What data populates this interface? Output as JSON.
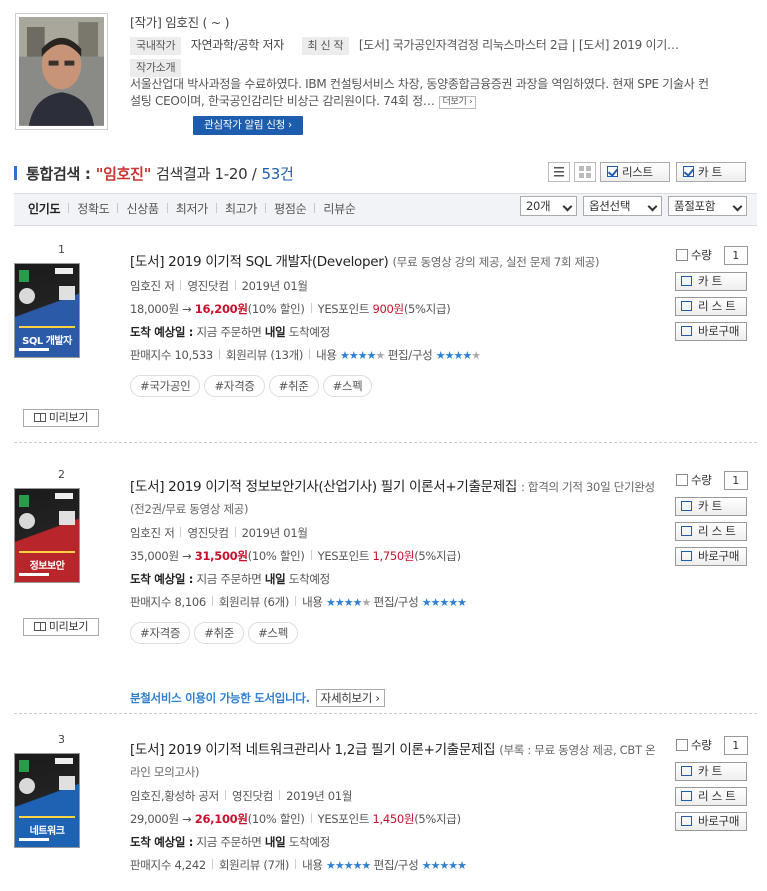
{
  "author": {
    "name_line": "[작가] 임호진 ( ~ )",
    "domestic_tag": "국내작가",
    "field": "자연과학/공학 저자",
    "latest_tag": "최 신 작",
    "latest_works": "[도서] 국가공인자격검정 리눅스마스터 2급  |  [도서] 2019 이기…",
    "intro_tag": "작가소개",
    "intro_text": "서울산업대 박사과정을 수료하였다. IBM 컨설팅서비스 차장, 동양종합금융증권 과장을 역임하였다. 현재 SPE 기술사 컨설팅 CEO이며, 한국공인감리단 비상근 감리원이다. 74회 정…",
    "more_label": "더보기",
    "alert_button": "관심작가 알림 신청"
  },
  "search": {
    "label": "통합검색 :",
    "query": "\"임호진\"",
    "result_text": "검색결과 1-20 /",
    "total": "53건",
    "list_button": "리스트",
    "cart_button": "카 트"
  },
  "sort": {
    "items": [
      "인기도",
      "정확도",
      "신상품",
      "최저가",
      "최고가",
      "평점순",
      "리뷰순"
    ],
    "per_page": "20개",
    "option_select": "옵션선택",
    "stock_select": "품절포함"
  },
  "common": {
    "preview_label": "미리보기",
    "qty_label": "수량",
    "qty_value": "1",
    "cart_btn": "카 트",
    "list_btn": "리 스 트",
    "buy_btn": "바로구매",
    "arrive_label": "도착 예상일 :",
    "arrive_text": "지금 주문하면",
    "arrive_day": "내일",
    "arrive_suffix": "도착예정",
    "content_label": "내용",
    "edit_label": "편집/구성"
  },
  "books": [
    {
      "rank": "1",
      "title": "[도서] 2019 이기적 SQL 개발자(Developer)",
      "subtitle": "(무료 동영상 강의 제공, 실전 문제 7회 제공)",
      "author": "임호진 저",
      "publisher": "영진닷컴",
      "date": "2019년 01월",
      "list_price": "18,000원 →",
      "sale_price": "16,200원",
      "discount": "(10% 할인)",
      "points_label": "YES포인트",
      "points": "900원",
      "points_rate": "(5%지급)",
      "sales_index": "판매지수 10,533",
      "reviews": "회원리뷰 (13개)",
      "content_rating": 4,
      "edit_rating": 4,
      "tags": [
        "#국가공인",
        "#자격증",
        "#취준",
        "#스펙"
      ],
      "cover_text": "SQL 개발자",
      "cover_color": "#2a5aa8"
    },
    {
      "rank": "2",
      "title": "[도서] 2019 이기적 정보보안기사(산업기사) 필기 이론서+기출문제집",
      "subtitle": ": 합격의 기적 30일 단기완성(전2권/무료 동영상 제공)",
      "author": "임호진 저",
      "publisher": "영진닷컴",
      "date": "2019년 01월",
      "list_price": "35,000원 →",
      "sale_price": "31,500원",
      "discount": "(10% 할인)",
      "points_label": "YES포인트",
      "points": "1,750원",
      "points_rate": "(5%지급)",
      "sales_index": "판매지수 8,106",
      "reviews": "회원리뷰 (6개)",
      "content_rating": 4,
      "edit_rating": 5,
      "tags": [
        "#자격증",
        "#취준",
        "#스펙"
      ],
      "cover_text": "정보보안",
      "cover_color": "#b8262b",
      "rental_text": "분철서비스 이용이 가능한 도서입니다.",
      "rental_button": "자세히보기"
    },
    {
      "rank": "3",
      "title": "[도서] 2019 이기적 네트워크관리사 1,2급 필기 이론+기출문제집",
      "subtitle": "(부록 : 무료 동영상 제공, CBT 온라인 모의고사)",
      "author": "임호진,황성하 공저",
      "publisher": "영진닷컴",
      "date": "2019년 01월",
      "list_price": "29,000원 →",
      "sale_price": "26,100원",
      "discount": "(10% 할인)",
      "points_label": "YES포인트",
      "points": "1,450원",
      "points_rate": "(5%지급)",
      "sales_index": "판매지수 4,242",
      "reviews": "회원리뷰 (7개)",
      "content_rating": 5,
      "edit_rating": 5,
      "cover_text": "네트워크",
      "cover_color": "#1e62b4"
    }
  ]
}
